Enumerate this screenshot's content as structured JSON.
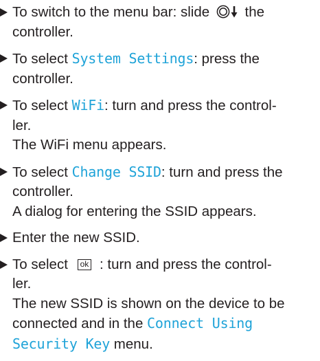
{
  "steps": [
    {
      "text_before": "To switch to the menu bar: slide ",
      "icon": "controller-slide-down-icon",
      "text_after": " the controller."
    },
    {
      "text_before": "To select ",
      "ui_term": "System Settings",
      "text_after": ": press the controller."
    },
    {
      "text_before": "To select ",
      "ui_term": "WiFi",
      "text_line1_after": ": turn and press the control-",
      "text_line2": "ler.",
      "result": "The WiFi menu appears."
    },
    {
      "text_before": "To select ",
      "ui_term": "Change SSID",
      "text_after": ": turn and press the controller.",
      "result": "A dialog for entering the SSID appears."
    },
    {
      "text": "Enter the new SSID."
    },
    {
      "text_before": "To select ",
      "key_label": "ok",
      "text_line1_after": " : turn and press the control-",
      "text_line2": "ler.",
      "result_before": "The new SSID is shown on the device to be connected and in the ",
      "result_ui_term": "Connect Using Security Key",
      "result_after": " menu."
    }
  ],
  "colors": {
    "text": "#231f20",
    "ui_term": "#1fa3d8"
  }
}
